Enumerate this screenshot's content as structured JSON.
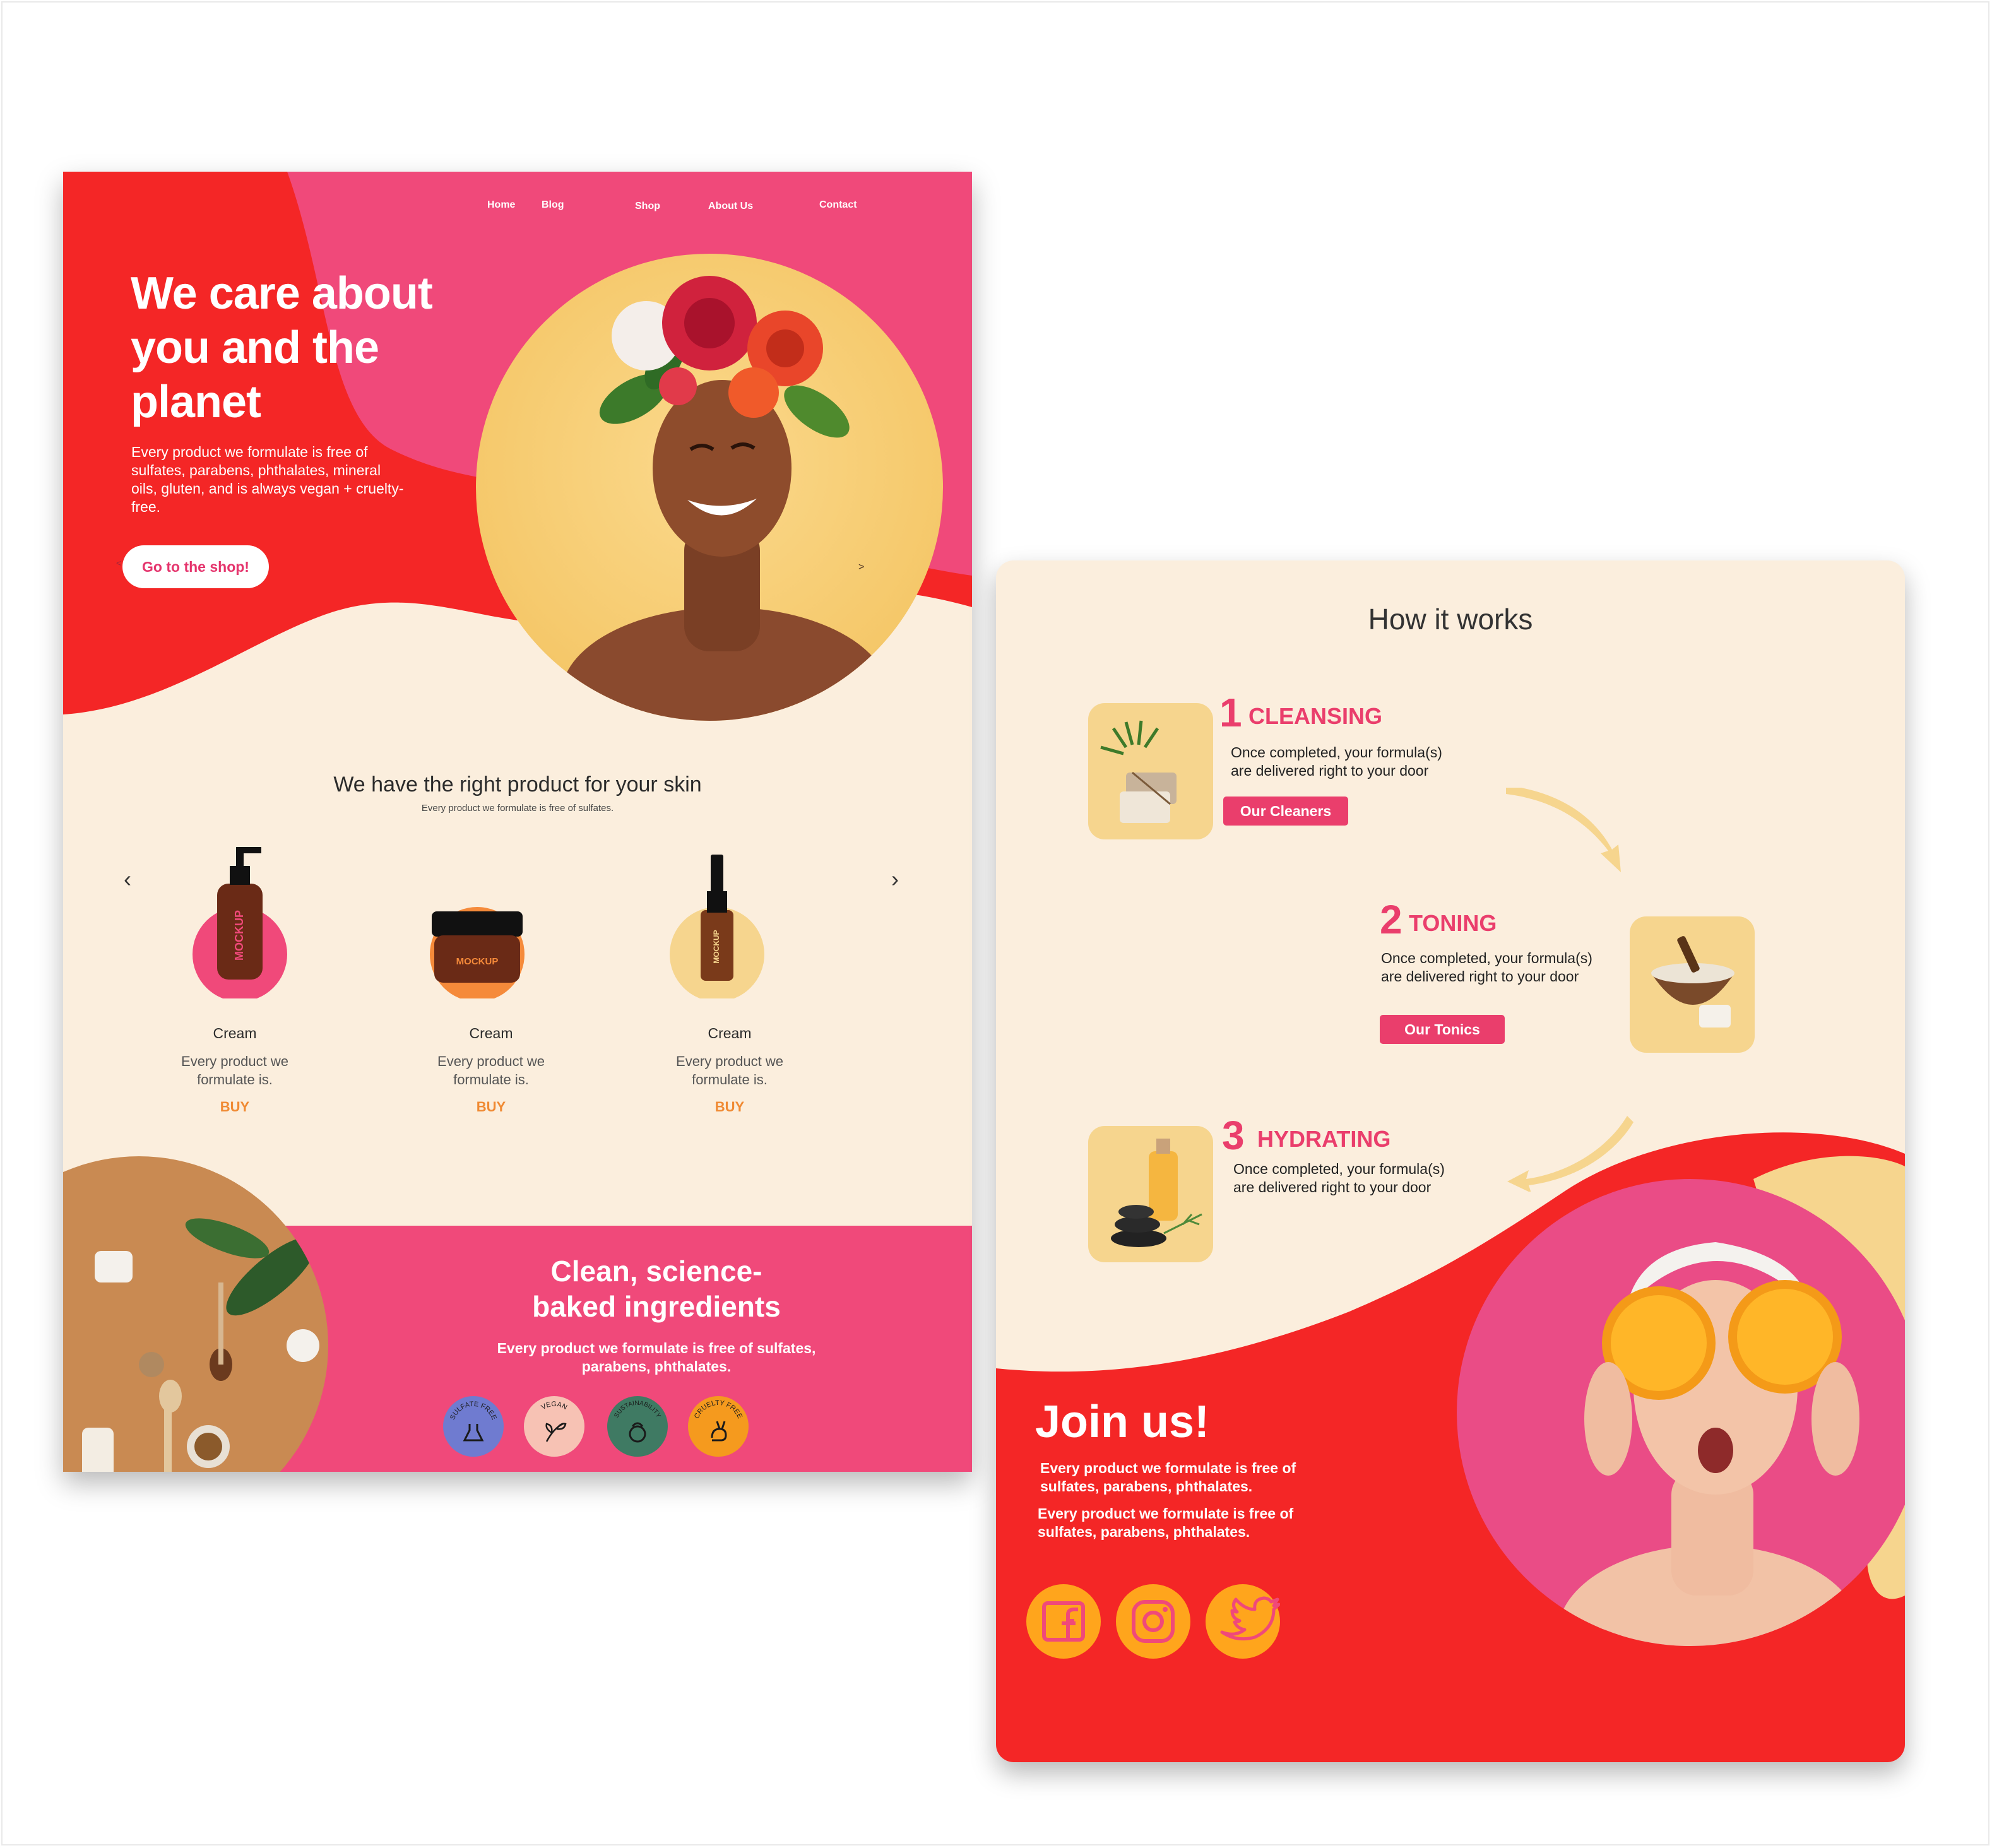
{
  "nav": {
    "home": "Home",
    "blog": "Blog",
    "shop": "Shop",
    "about": "About Us",
    "contact": "Contact"
  },
  "hero": {
    "title_line1": "We care about",
    "title_line2": "you and the",
    "title_line3": "planet",
    "subtitle": "Every product we formulate is free of sulfates, parabens, phthalates, mineral oils, gluten, and is always vegan + cruelty-free.",
    "cta": "Go to the shop!",
    "prev": "<",
    "next": ">"
  },
  "products_section": {
    "title": "We have the right product for your skin",
    "subtitle": "Every product we formulate is free of sulfates.",
    "prev": "‹",
    "next": "›",
    "items": [
      {
        "name": "Cream",
        "desc": "Every product we formulate is.",
        "buy": "BUY",
        "label": "MOCKUP",
        "accent": "#f0497a"
      },
      {
        "name": "Cream",
        "desc": "Every product we formulate is.",
        "buy": "BUY",
        "label": "MOCKUP",
        "accent": "#f58a3a"
      },
      {
        "name": "Cream",
        "desc": "Every product we formulate is.",
        "buy": "BUY",
        "label": "MOCKUP",
        "accent": "#f6d58e"
      }
    ]
  },
  "ingredients": {
    "title_line1": "Clean, science-",
    "title_line2": "baked ingredients",
    "subtitle": "Every product we formulate is free of sulfates, parabens, phthalates.",
    "badges": [
      {
        "label": "SULFATE FREE",
        "icon": "flask-icon",
        "color": "#6f7bd0"
      },
      {
        "label": "VEGAN",
        "icon": "leaf-icon",
        "color": "#f7c2b4"
      },
      {
        "label": "SUSTAINABILITY",
        "icon": "earth-icon",
        "color": "#3f7a63"
      },
      {
        "label": "CRUELTY FREE",
        "icon": "rabbit-icon",
        "color": "#f59a1e"
      }
    ]
  },
  "how": {
    "title": "How it works",
    "steps": [
      {
        "num": "1",
        "title": "CLEANSING",
        "desc_line1": "Once completed, your formula(s)",
        "desc_line2": "are delivered right to your door",
        "button": "Our Cleaners",
        "icon": "soap-icon"
      },
      {
        "num": "2",
        "title": "TONING",
        "desc_line1": "Once completed, your formula(s)",
        "desc_line2": "are delivered right to your door",
        "button": "Our Tonics",
        "icon": "bowl-icon"
      },
      {
        "num": "3",
        "title": "HYDRATING",
        "desc_line1": "Once completed, your formula(s)",
        "desc_line2": "are delivered right to your door",
        "icon": "oil-stones-icon"
      }
    ]
  },
  "join": {
    "title": "Join us!",
    "text1_line1": "Every product we formulate is free of",
    "text1_line2": "sulfates, parabens, phthalates.",
    "text2_line1": "Every product we formulate is free of",
    "text2_line2": "sulfates, parabens, phthalates.",
    "social": [
      "facebook-icon",
      "instagram-icon",
      "twitter-icon"
    ]
  },
  "colors": {
    "red": "#f42626",
    "pink": "#f0497a",
    "cream": "#fbeedd",
    "yellow": "#f6d58e",
    "orange": "#ffa51c"
  }
}
